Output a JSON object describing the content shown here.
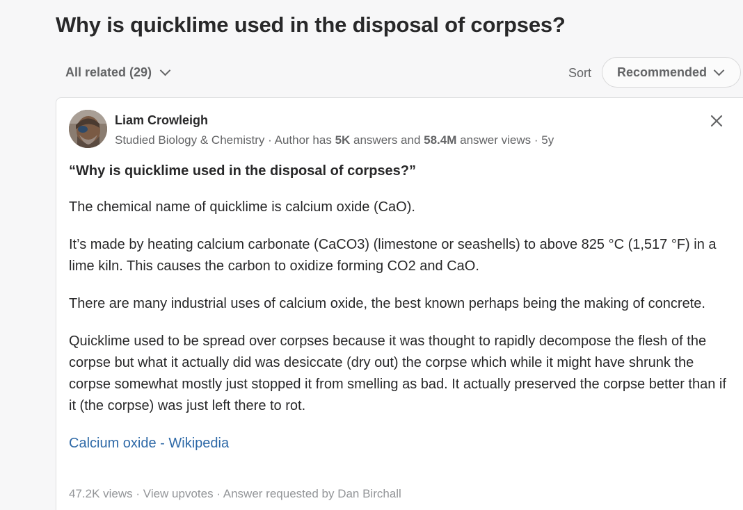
{
  "question": {
    "title": "Why is quicklime used in the disposal of corpses?"
  },
  "filters": {
    "all_related_label": "All related (29)",
    "sort_label": "Sort",
    "sort_value": "Recommended"
  },
  "answer": {
    "author": {
      "name": "Liam Crowleigh",
      "credential": "Studied Biology & Chemistry",
      "sep1": " · Author has ",
      "answers_count": "5K",
      "answers_text": " answers and ",
      "views_count": "58.4M",
      "views_text": " answer views · ",
      "age": "5y"
    },
    "quote": "“Why is quicklime used in the disposal of corpses?”",
    "paragraphs": [
      "The chemical name of quicklime is calcium oxide (CaO).",
      "It’s made by heating calcium carbonate (CaCO3) (limestone or seashells) to above 825 °C (1,517 °F) in a lime kiln. This causes the carbon to oxidize forming CO2 and CaO.",
      "There are many industrial uses of calcium oxide, the best known perhaps being the making of concrete.",
      "Quicklime used to be spread over corpses because it was thought to rapidly decompose the flesh of the corpse but what it actually did was desiccate (dry out) the corpse which while it might have shrunk the corpse somewhat mostly just stopped it from smelling as bad. It actually preserved the corpse better than if it (the corpse) was just left there to rot."
    ],
    "link_text": "Calcium oxide - Wikipedia",
    "footer": {
      "views": "47.2K views",
      "sep": " · ",
      "upvotes": "View upvotes",
      "requested": "Answer requested by Dan Birchall"
    }
  },
  "icons": {
    "close": "close-icon",
    "chevron": "chevron-down-icon"
  },
  "colors": {
    "link": "#2e69a7",
    "text": "#282829",
    "muted": "#636466",
    "faint": "#939598"
  }
}
